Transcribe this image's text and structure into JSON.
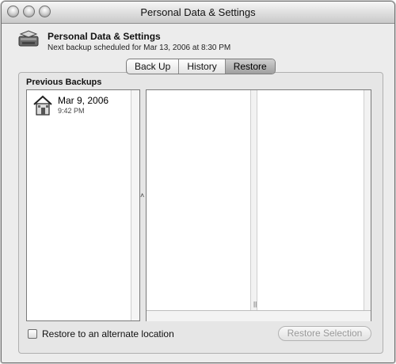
{
  "window": {
    "title": "Personal Data & Settings"
  },
  "header": {
    "title": "Personal Data & Settings",
    "subtitle": "Next backup scheduled for Mar 13, 2006 at 8:30 PM",
    "icon": "backup-drive-icon"
  },
  "tabs": [
    {
      "label": "Back Up",
      "active": false
    },
    {
      "label": "History",
      "active": false
    },
    {
      "label": "Restore",
      "active": true
    }
  ],
  "backups": {
    "heading": "Previous Backups",
    "items": [
      {
        "date": "Mar 9, 2006",
        "time": "9:42 PM",
        "icon": "house-icon"
      }
    ]
  },
  "options": {
    "alternate_location_label": "Restore to an alternate location",
    "alternate_location_checked": false
  },
  "actions": {
    "restore_label": "Restore Selection",
    "restore_enabled": false
  }
}
